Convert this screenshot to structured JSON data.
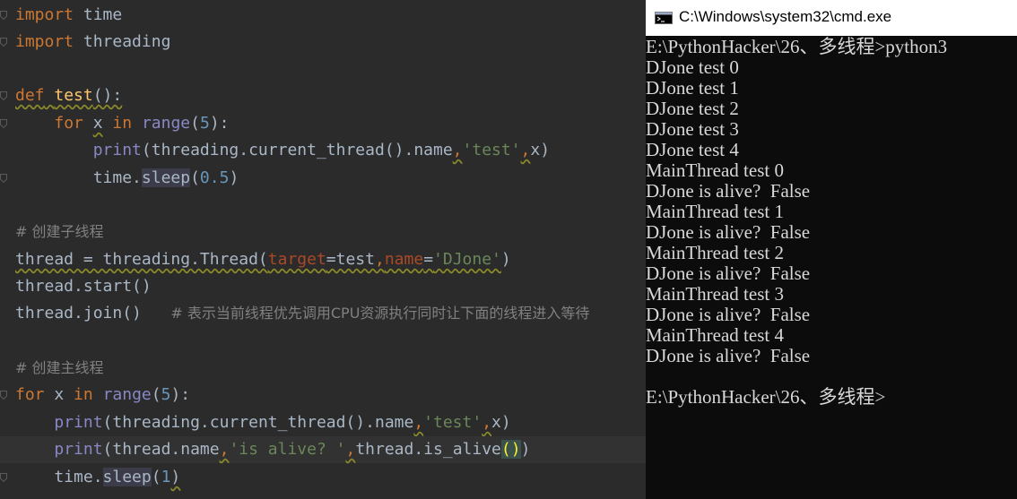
{
  "editor": {
    "lines": [
      {
        "tokens": [
          {
            "t": "import",
            "c": "kw"
          },
          {
            "t": " time",
            "c": ""
          }
        ],
        "fold": true
      },
      {
        "tokens": [
          {
            "t": "import",
            "c": "kw"
          },
          {
            "t": " threading",
            "c": ""
          }
        ],
        "fold": true
      },
      {
        "tokens": [],
        "fold": false
      },
      {
        "tokens": [
          {
            "t": "def",
            "c": "kw squig"
          },
          {
            "t": " ",
            "c": "squig"
          },
          {
            "t": "test",
            "c": "fn squig"
          },
          {
            "t": "():",
            "c": "squig"
          }
        ],
        "fold": true
      },
      {
        "tokens": [
          {
            "t": "    ",
            "c": ""
          },
          {
            "t": "for",
            "c": "kw"
          },
          {
            "t": " ",
            "c": ""
          },
          {
            "t": "x",
            "c": "squig"
          },
          {
            "t": " ",
            "c": ""
          },
          {
            "t": "in",
            "c": "kw"
          },
          {
            "t": " ",
            "c": ""
          },
          {
            "t": "range",
            "c": "bi"
          },
          {
            "t": "(",
            "c": ""
          },
          {
            "t": "5",
            "c": "num"
          },
          {
            "t": "):",
            "c": ""
          }
        ],
        "fold": true
      },
      {
        "tokens": [
          {
            "t": "        ",
            "c": ""
          },
          {
            "t": "print",
            "c": "bi"
          },
          {
            "t": "(threading.current_thread().name",
            "c": ""
          },
          {
            "t": ",",
            "c": "kw squig"
          },
          {
            "t": "'test'",
            "c": "str"
          },
          {
            "t": ",",
            "c": "kw squig"
          },
          {
            "t": "x)",
            "c": ""
          }
        ],
        "fold": false
      },
      {
        "tokens": [
          {
            "t": "        time.",
            "c": ""
          },
          {
            "t": "sleep",
            "c": "hl-sleep"
          },
          {
            "t": "(",
            "c": ""
          },
          {
            "t": "0.5",
            "c": "num"
          },
          {
            "t": ")",
            "c": ""
          }
        ],
        "fold": true
      },
      {
        "tokens": [],
        "fold": false
      },
      {
        "tokens": [
          {
            "t": "# 创建子线程",
            "c": "cmt"
          }
        ],
        "fold": false
      },
      {
        "tokens": [
          {
            "t": "thread = threading.Thread(",
            "c": "squig"
          },
          {
            "t": "target",
            "c": "param squig"
          },
          {
            "t": "=test",
            "c": "squig"
          },
          {
            "t": ",",
            "c": "kw squig"
          },
          {
            "t": "name",
            "c": "param squig"
          },
          {
            "t": "=",
            "c": "squig"
          },
          {
            "t": "'DJone'",
            "c": "str squig"
          },
          {
            "t": ")",
            "c": ""
          }
        ],
        "fold": false
      },
      {
        "tokens": [
          {
            "t": "thread.start()",
            "c": ""
          }
        ],
        "fold": false
      },
      {
        "tokens": [
          {
            "t": "thread.join()   ",
            "c": ""
          },
          {
            "t": "# 表示当前线程优先调用CPU资源执行同时让下面的线程进入等待",
            "c": "cmt"
          }
        ],
        "fold": false
      },
      {
        "tokens": [],
        "fold": false
      },
      {
        "tokens": [
          {
            "t": "# 创建主线程",
            "c": "cmt"
          }
        ],
        "fold": false
      },
      {
        "tokens": [
          {
            "t": "for",
            "c": "kw"
          },
          {
            "t": " x ",
            "c": ""
          },
          {
            "t": "in",
            "c": "kw"
          },
          {
            "t": " ",
            "c": ""
          },
          {
            "t": "range",
            "c": "bi"
          },
          {
            "t": "(",
            "c": ""
          },
          {
            "t": "5",
            "c": "num"
          },
          {
            "t": "):",
            "c": ""
          }
        ],
        "fold": true
      },
      {
        "tokens": [
          {
            "t": "    ",
            "c": ""
          },
          {
            "t": "print",
            "c": "bi"
          },
          {
            "t": "(threading.current_thread().name",
            "c": ""
          },
          {
            "t": ",",
            "c": "kw squig"
          },
          {
            "t": "'test'",
            "c": "str"
          },
          {
            "t": ",",
            "c": "kw squig"
          },
          {
            "t": "x)",
            "c": ""
          }
        ],
        "fold": false
      },
      {
        "tokens": [
          {
            "t": "    ",
            "c": ""
          },
          {
            "t": "print",
            "c": "bi"
          },
          {
            "t": "(thread.name",
            "c": ""
          },
          {
            "t": ",",
            "c": "kw squig"
          },
          {
            "t": "'is alive? '",
            "c": "str"
          },
          {
            "t": ",",
            "c": "kw squig"
          },
          {
            "t": "thread.is_alive",
            "c": ""
          },
          {
            "t": "()",
            "c": "brace"
          },
          {
            "t": ")",
            "c": ""
          }
        ],
        "fold": false,
        "current": true
      },
      {
        "tokens": [
          {
            "t": "    time.",
            "c": ""
          },
          {
            "t": "sleep",
            "c": "hl-sleep"
          },
          {
            "t": "(",
            "c": ""
          },
          {
            "t": "1",
            "c": "num"
          },
          {
            "t": ")",
            "c": "squig"
          }
        ],
        "fold": true
      }
    ]
  },
  "cmd": {
    "title": "C:\\Windows\\system32\\cmd.exe",
    "icon": "cmd-icon",
    "lines": [
      "E:\\PythonHacker\\26、多线程>python3",
      "DJone test 0",
      "DJone test 1",
      "DJone test 2",
      "DJone test 3",
      "DJone test 4",
      "MainThread test 0",
      "DJone is alive?  False",
      "MainThread test 1",
      "DJone is alive?  False",
      "MainThread test 2",
      "DJone is alive?  False",
      "MainThread test 3",
      "DJone is alive?  False",
      "MainThread test 4",
      "DJone is alive?  False",
      "",
      "E:\\PythonHacker\\26、多线程>"
    ]
  },
  "colors": {
    "editor_bg": "#2b2b2b",
    "keyword": "#cc7832",
    "function": "#ffc66d",
    "builtin": "#8888c6",
    "number": "#6897bb",
    "string": "#6a8759",
    "param": "#aa4926",
    "comment": "#808080",
    "cmd_bg": "#0c0c0c",
    "cmd_fg": "#d8d8d8"
  }
}
